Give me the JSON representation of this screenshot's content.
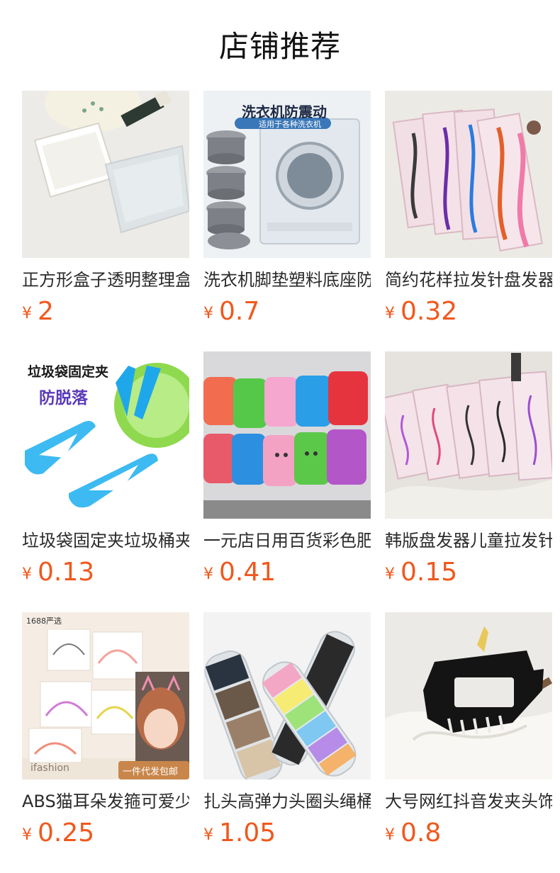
{
  "header": {
    "title": "店铺推荐"
  },
  "currency_symbol": "¥",
  "products": [
    {
      "name": "正方形盒子透明整理盒",
      "price": "2",
      "image_icon": "square-box-image"
    },
    {
      "name": "洗衣机脚垫塑料底座防震",
      "price": "0.7",
      "image_icon": "washing-machine-pad-image",
      "image_text": {
        "headline": "洗衣机防震动",
        "sub": "适用于各种洗衣机"
      }
    },
    {
      "name": "简约花样拉发针盘发器",
      "price": "0.32",
      "image_icon": "hair-twist-pin-image"
    },
    {
      "name": "垃圾袋固定夹垃圾桶夹",
      "price": "0.13",
      "image_icon": "trash-bag-clip-image",
      "image_text": {
        "headline": "垃圾袋固定夹",
        "sub": "防脱落"
      }
    },
    {
      "name": "一元店日用百货彩色肥皂盒",
      "price": "0.41",
      "image_icon": "soap-box-image"
    },
    {
      "name": "韩版盘发器儿童拉发针",
      "price": "0.15",
      "image_icon": "hair-tool-pack-image"
    },
    {
      "name": "ABS猫耳朵发箍可爱少女",
      "price": "0.25",
      "image_icon": "cat-ear-headband-image",
      "image_text": {
        "badge": "1688严选",
        "brand": "ifashion",
        "ribbon": "一件代发包邮"
      }
    },
    {
      "name": "扎头高弹力头圈头绳桶装",
      "price": "1.05",
      "image_icon": "hair-tie-tube-image"
    },
    {
      "name": "大号网红抖音发夹头饰",
      "price": "0.8",
      "image_icon": "hair-claw-clip-image"
    }
  ],
  "colors": {
    "price": "#f0581d",
    "title": "#111111",
    "name": "#2b2b2b"
  }
}
